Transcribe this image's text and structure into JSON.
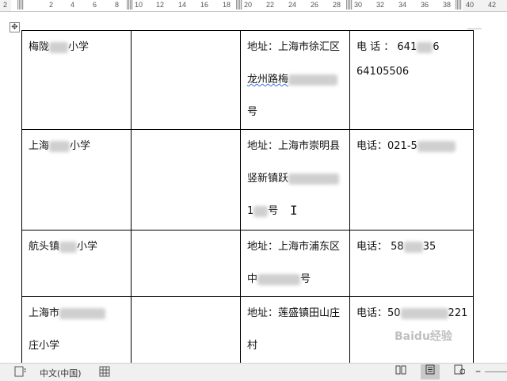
{
  "ruler": {
    "labels": [
      "2",
      "2",
      "4",
      "6",
      "8",
      "10",
      "12",
      "14",
      "16",
      "18",
      "20",
      "22",
      "24",
      "26",
      "28",
      "30",
      "32",
      "34",
      "36",
      "38",
      "40",
      "42"
    ]
  },
  "table": {
    "rows": [
      {
        "name_prefix": "梅陇",
        "name_suffix": "小学",
        "addr_line1": "地址：上海市徐汇区",
        "addr_line2_prefix": "龙州路梅",
        "addr_line3": "号",
        "phone_line1_prefix": "电  话 ：  641",
        "phone_line1_suffix": "6",
        "phone_line2": "64105506"
      },
      {
        "name_prefix": "上海",
        "name_suffix": "小学",
        "addr_line1": "地址：上海市崇明县",
        "addr_line2_prefix": "竖新镇跃",
        "addr_line3_prefix": "1",
        "addr_line3_suffix": "号",
        "phone_prefix": "电话：021-5"
      },
      {
        "name_prefix": "航头镇",
        "name_suffix": "小学",
        "addr_line1": "地址：上海市浦东区",
        "addr_line2_prefix": "中",
        "addr_line2_suffix": "号",
        "phone_prefix": "电话：  58",
        "phone_suffix": "35"
      },
      {
        "name_line1_prefix": "上海市",
        "name_line2": "庄小学",
        "addr_line1": "地址：莲盛镇田山庄",
        "addr_line2": "村",
        "phone_prefix": "电话：50",
        "phone_suffix": "221"
      }
    ]
  },
  "statusbar": {
    "language": "中文(中国)"
  },
  "watermark": "Baidu经验"
}
